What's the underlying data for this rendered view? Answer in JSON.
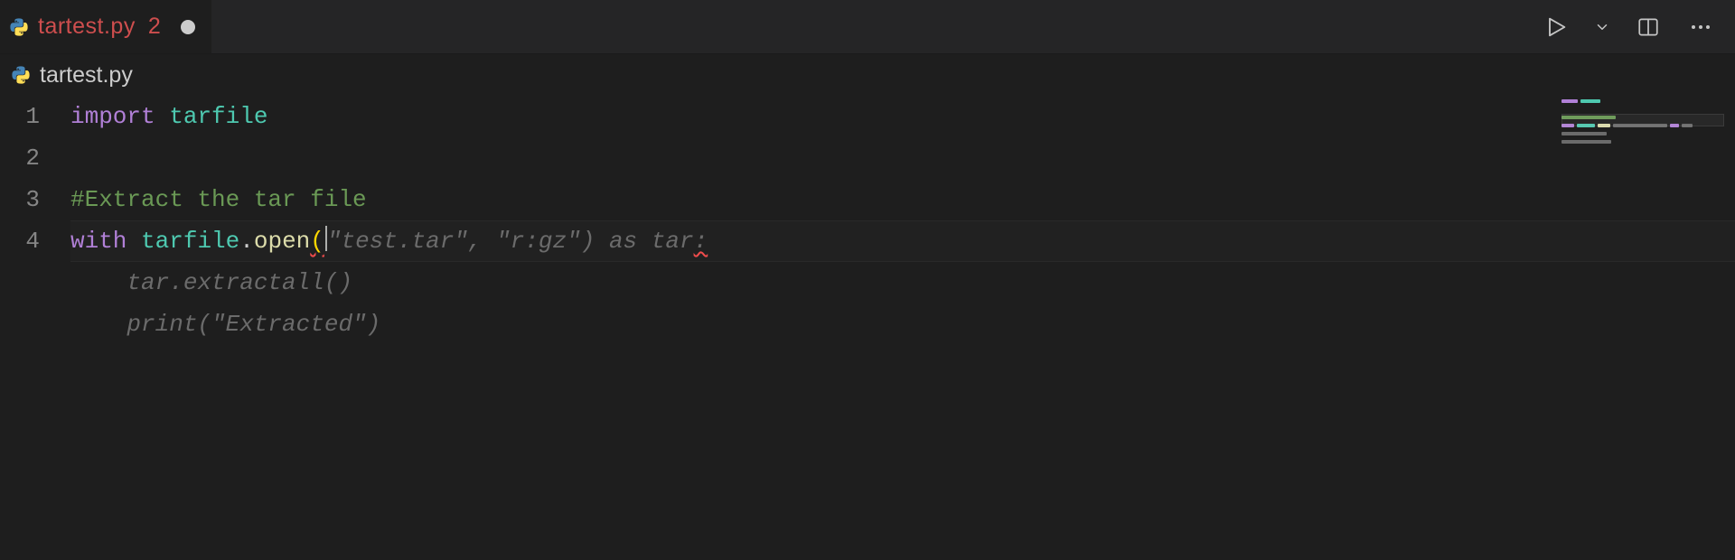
{
  "colors": {
    "bg": "#1e1e1e",
    "tabbar": "#252526",
    "modified_tab": "#ce4e4e",
    "keyword": "#b180d7",
    "type": "#4ec9b0",
    "func": "#dcdcaa",
    "comment": "#6a9955",
    "ghost": "#6b6b6b",
    "paren_active": "#ffd700",
    "error_squiggle": "#f14c4c"
  },
  "tab": {
    "icon": "python-icon",
    "label": "tartest.py",
    "problems_count": "2",
    "dirty": true
  },
  "actions": {
    "run": "run-icon",
    "run_dropdown": "chevron-down-icon",
    "split": "split-editor-icon",
    "more": "more-icon"
  },
  "breadcrumb": {
    "icon": "python-icon",
    "file": "tartest.py"
  },
  "editor": {
    "gutter": [
      "1",
      "2",
      "3",
      "4"
    ],
    "line1": {
      "kw_import": "import",
      "sp": " ",
      "module": "tarfile"
    },
    "line2": {
      "blank": ""
    },
    "line3": {
      "comment": "#Extract the tar file"
    },
    "line4": {
      "kw_with": "with",
      "sp": " ",
      "module": "tarfile",
      "dot": ".",
      "fn": "open",
      "paren_open": "(",
      "ghost_args": "\"test.tar\", \"r:gz\")",
      "sp2": " ",
      "kw_as": "as",
      "sp3": " ",
      "ghost_var": "tar",
      "ghost_colon": ":"
    },
    "ghost_line5": "    tar.extractall()",
    "ghost_line6": "    print(\"Extracted\")"
  },
  "minimap": {
    "lines": [
      [
        [
          "#b180d7",
          18
        ],
        [
          "#4ec9b0",
          22
        ]
      ],
      [],
      [
        [
          "#6a9955",
          60
        ]
      ],
      [
        [
          "#b180d7",
          14
        ],
        [
          "#4ec9b0",
          20
        ],
        [
          "#dcdcaa",
          14
        ],
        [
          "#6b6b6b",
          60
        ],
        [
          "#b180d7",
          10
        ],
        [
          "#6b6b6b",
          12
        ]
      ],
      [
        [
          "#6b6b6b",
          50
        ]
      ],
      [
        [
          "#6b6b6b",
          55
        ]
      ]
    ]
  }
}
